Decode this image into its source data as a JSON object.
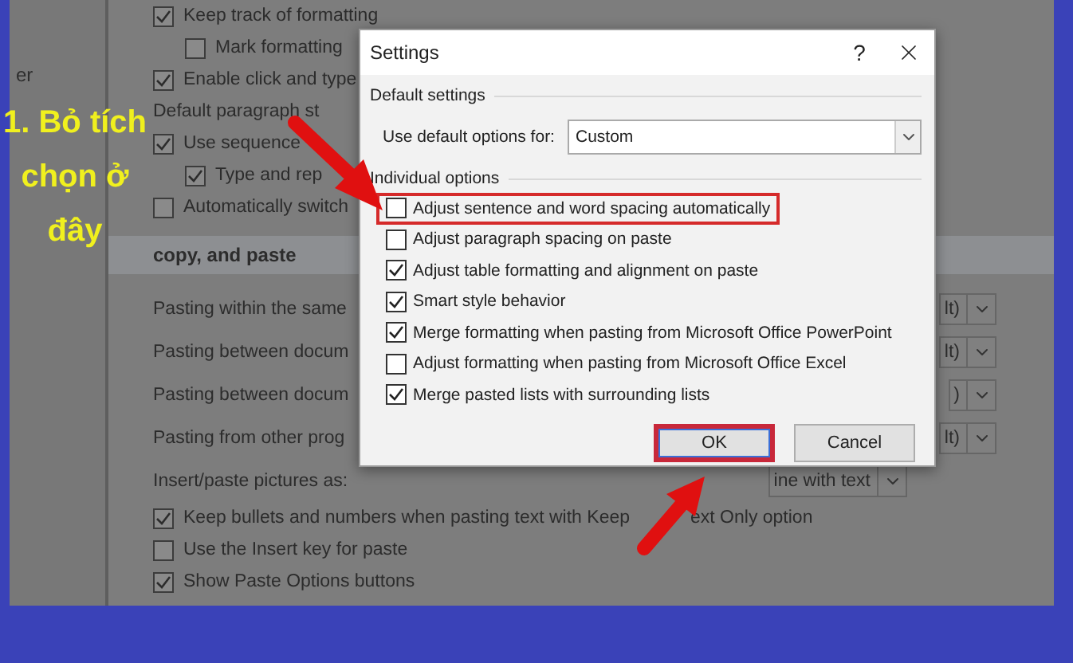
{
  "background_window": {
    "sidebar_fragment": "er",
    "options_top": [
      {
        "label": "Keep track of formatting",
        "checked": true,
        "children": [
          {
            "label": "Mark formatting",
            "checked": false
          }
        ]
      },
      {
        "label": "Enable click and type",
        "checked": true
      },
      {
        "label": "Default paragraph st",
        "kind": "text"
      },
      {
        "label": "Use sequence",
        "checked": true,
        "children": [
          {
            "label": "Type and rep",
            "checked": true
          }
        ]
      },
      {
        "label": "Automatically switch",
        "checked": false
      }
    ],
    "section_header": "copy, and paste",
    "paste_rows": [
      {
        "label": "Pasting within the same",
        "value": "lt)"
      },
      {
        "label": "Pasting between docum",
        "value": "lt)"
      },
      {
        "label": "Pasting between docum",
        "value": ")"
      },
      {
        "label": "Pasting from other prog",
        "value": "lt)"
      }
    ],
    "pictures_row": {
      "label": "Insert/paste pictures as:",
      "value": "ine with text"
    },
    "options_bottom": [
      {
        "label": "Keep bullets and numbers when pasting text with Keep",
        "label_continued": "ext Only option",
        "checked": true
      },
      {
        "label": "Use the Insert key for paste",
        "checked": false
      },
      {
        "label": "Show Paste Options buttons",
        "checked": true
      }
    ]
  },
  "dialog": {
    "title": "Settings",
    "help": "?",
    "default_group": "Default settings",
    "default_label": "Use default options for:",
    "default_value": "Custom",
    "individual_group": "Individual options",
    "options": [
      {
        "label": "Adjust sentence and word spacing automatically",
        "checked": false,
        "highlighted": true
      },
      {
        "label": "Adjust paragraph spacing on paste",
        "checked": false,
        "highlighted": false
      },
      {
        "label": "Adjust table formatting and alignment on paste",
        "checked": true,
        "highlighted": false
      },
      {
        "label": "Smart style behavior",
        "checked": true,
        "highlighted": false
      },
      {
        "label": "Merge formatting when pasting from Microsoft Office PowerPoint",
        "checked": true,
        "highlighted": false
      },
      {
        "label": "Adjust formatting when pasting from Microsoft Office Excel",
        "checked": false,
        "highlighted": false
      },
      {
        "label": "Merge pasted lists with surrounding lists",
        "checked": true,
        "highlighted": false
      }
    ],
    "buttons": [
      {
        "label": "OK",
        "highlighted": true
      },
      {
        "label": "Cancel",
        "highlighted": false
      }
    ]
  },
  "annotation": {
    "lines": [
      "1. Bỏ tích",
      "chọn ở",
      "đây"
    ]
  }
}
